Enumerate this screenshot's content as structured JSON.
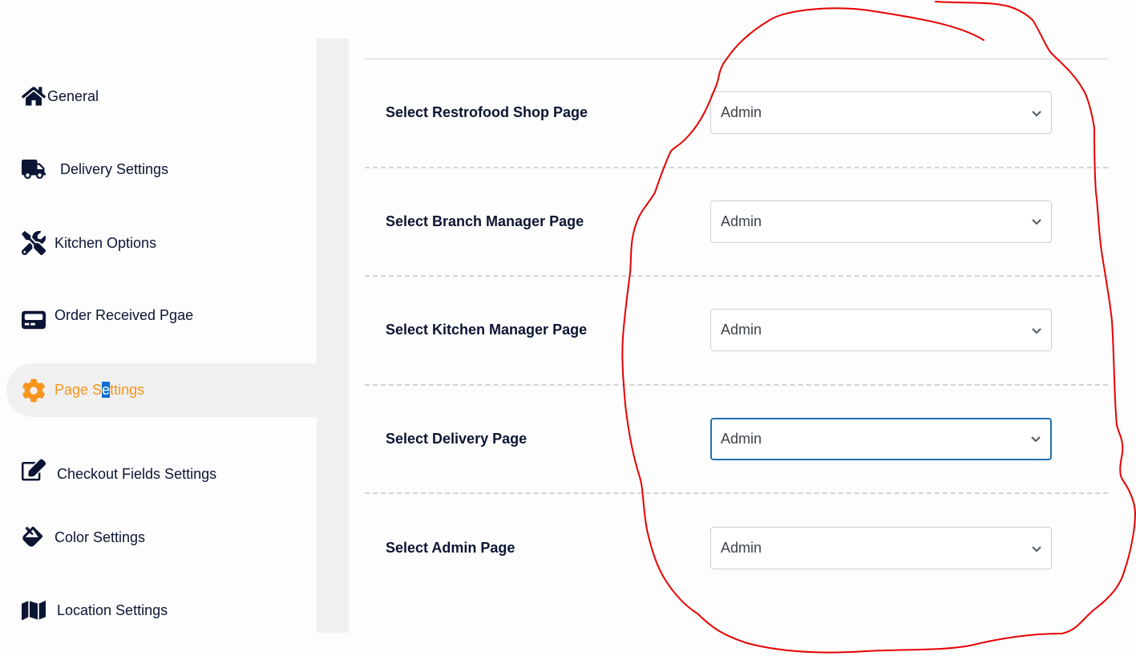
{
  "sidebar": {
    "items": [
      {
        "label": "General",
        "icon": "home-icon"
      },
      {
        "label": "Delivery Settings",
        "icon": "truck-icon"
      },
      {
        "label": "Kitchen Options",
        "icon": "tools-icon"
      },
      {
        "label": "Order Received Pgae",
        "icon": "pager-icon"
      },
      {
        "label_before": "Page S",
        "label_selected": "e",
        "label_after": "ttings",
        "icon": "gear-icon",
        "active": true
      },
      {
        "label": "Checkout Fields Settings",
        "icon": "edit-icon"
      },
      {
        "label": "Color Settings",
        "icon": "fill-drip-icon"
      },
      {
        "label": "Location Settings",
        "icon": "map-icon"
      }
    ]
  },
  "settings": {
    "rows": [
      {
        "label": "Select Restrofood Shop Page",
        "value": "Admin"
      },
      {
        "label": "Select Branch Manager Page",
        "value": "Admin"
      },
      {
        "label": "Select Kitchen Manager Page",
        "value": "Admin"
      },
      {
        "label": "Select Delivery Page",
        "value": "Admin",
        "focused": true
      },
      {
        "label": "Select Admin Page",
        "value": "Admin"
      }
    ]
  },
  "colors": {
    "accent": "#f7941d",
    "text": "#0b1533",
    "focus_border": "#2271b1",
    "annotation": "#e60000"
  }
}
